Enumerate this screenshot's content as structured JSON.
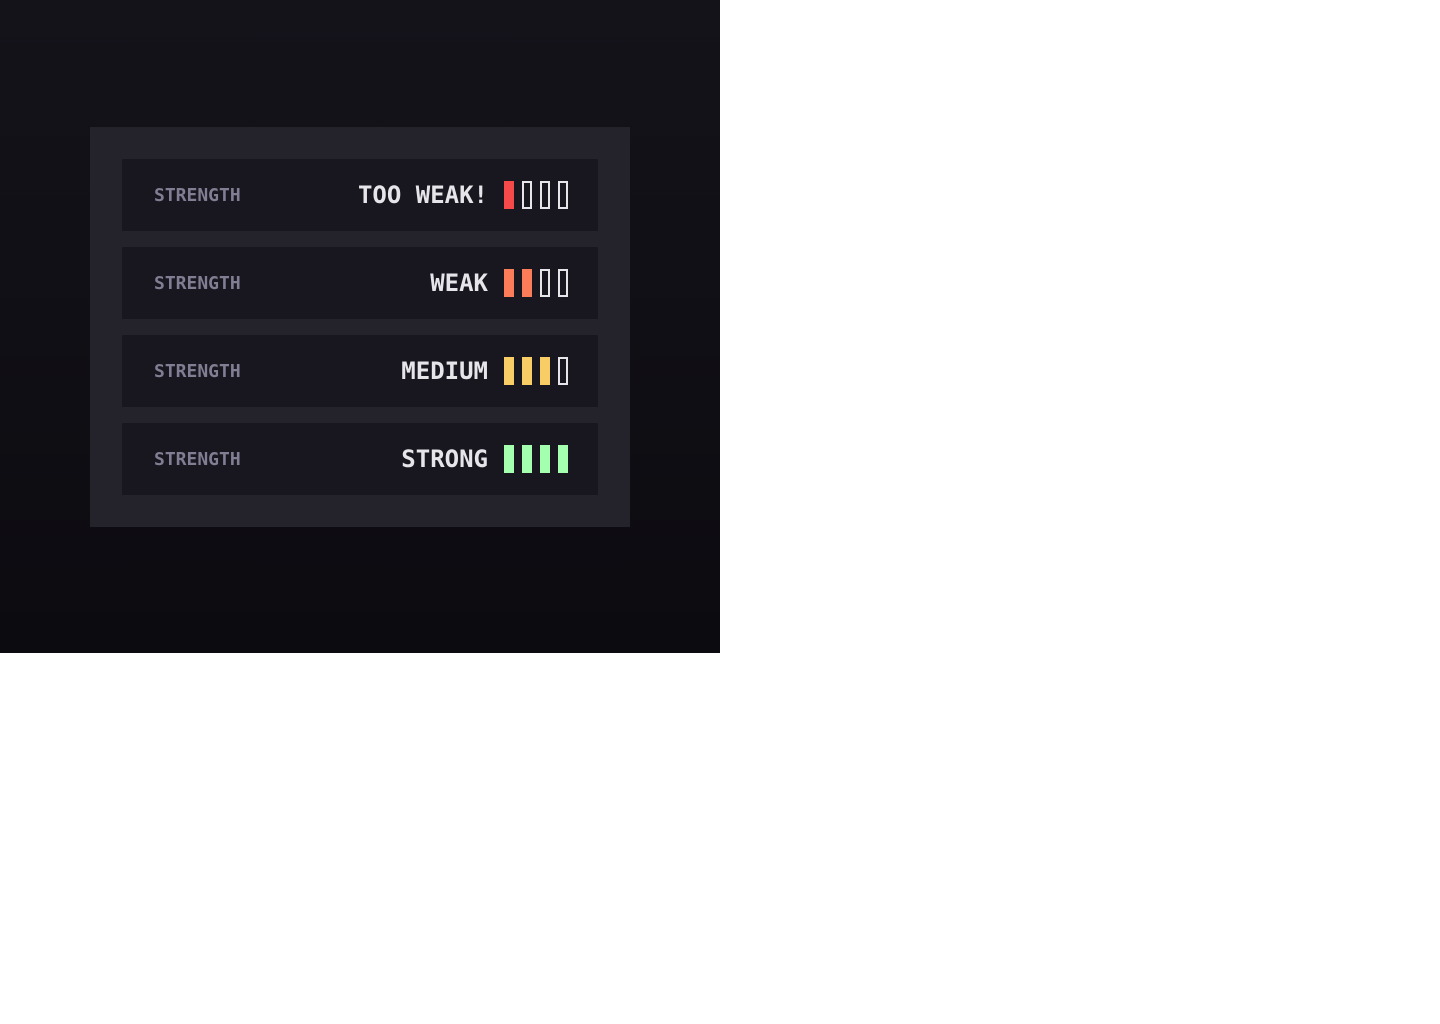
{
  "colors": {
    "empty_border": "#e6e5ea"
  },
  "rows": [
    {
      "label": "STRENGTH",
      "level": "TOO WEAK!",
      "filled": 1,
      "total": 4,
      "color": "#f64a4a"
    },
    {
      "label": "STRENGTH",
      "level": "WEAK",
      "filled": 2,
      "total": 4,
      "color": "#fb7c58"
    },
    {
      "label": "STRENGTH",
      "level": "MEDIUM",
      "filled": 3,
      "total": 4,
      "color": "#f8cd65"
    },
    {
      "label": "STRENGTH",
      "level": "STRONG",
      "filled": 4,
      "total": 4,
      "color": "#a4ffaf"
    }
  ]
}
